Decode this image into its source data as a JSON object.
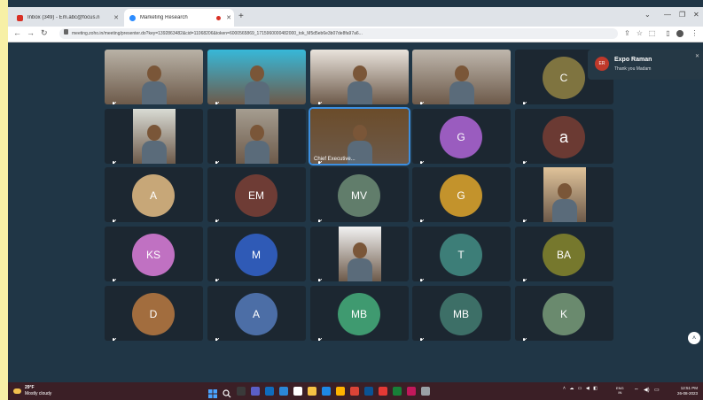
{
  "browser": {
    "tabs": [
      {
        "label": "Inbox (349) - Em.abc@focus.n",
        "favicon_color": "#d93025",
        "active": false
      },
      {
        "label": "Marketing Research",
        "favicon_color": "#2d8cff",
        "active": true
      }
    ],
    "url": "meeting.zoho.in/meeting/presenter.do?key=1392863482&cid=11068206&token=6000565869_1715960000482000_tok_M5d5eb6e3b07de8fa97a6...",
    "icons": [
      "back-icon",
      "forward-icon",
      "reload-icon",
      "lock-icon",
      "share-icon",
      "star-icon",
      "extension-icon",
      "profile-icon",
      "menu-icon"
    ]
  },
  "meeting": {
    "participants": [
      {
        "initials": "",
        "type": "video",
        "tone": "#b9b2a6"
      },
      {
        "initials": "",
        "type": "video",
        "tone": "#37b8d8"
      },
      {
        "initials": "",
        "type": "video",
        "tone": "#e9e3dc"
      },
      {
        "initials": "",
        "type": "video",
        "tone": "#bfb7ad"
      },
      {
        "initials": "C",
        "type": "avatar",
        "color": "#7f7440"
      },
      {
        "initials": "",
        "type": "video",
        "tone": "#d9dbd4"
      },
      {
        "initials": "",
        "type": "video",
        "tone": "#a59d90"
      },
      {
        "initials": "",
        "type": "video",
        "tone": "#6b4c2a",
        "caption": "Chief Executive...",
        "speaking": true
      },
      {
        "initials": "G",
        "type": "avatar",
        "color": "#9a5cbf"
      },
      {
        "initials": "a",
        "type": "avatar",
        "color": "#6b3a33",
        "big": true
      },
      {
        "initials": "A",
        "type": "avatar",
        "color": "#c7a778"
      },
      {
        "initials": "EM",
        "type": "avatar",
        "color": "#6e3c35"
      },
      {
        "initials": "MV",
        "type": "avatar",
        "color": "#617d6b"
      },
      {
        "initials": "G",
        "type": "avatar",
        "color": "#c3932c"
      },
      {
        "initials": "",
        "type": "video",
        "tone": "#e0c39a"
      },
      {
        "initials": "KS",
        "type": "avatar",
        "color": "#c071c2"
      },
      {
        "initials": "M",
        "type": "avatar",
        "color": "#2f5ab6"
      },
      {
        "initials": "",
        "type": "video",
        "tone": "#f2f2f2"
      },
      {
        "initials": "T",
        "type": "avatar",
        "color": "#3d7e78"
      },
      {
        "initials": "BA",
        "type": "avatar",
        "color": "#76782d"
      },
      {
        "initials": "D",
        "type": "avatar",
        "color": "#a26d3e"
      },
      {
        "initials": "A",
        "type": "avatar",
        "color": "#4c6ea6"
      },
      {
        "initials": "MB",
        "type": "avatar",
        "color": "#3f9a70"
      },
      {
        "initials": "MB",
        "type": "avatar",
        "color": "#3d6f67"
      },
      {
        "initials": "K",
        "type": "avatar",
        "color": "#6a8a6e"
      }
    ],
    "notification": {
      "initials": "ER",
      "name": "Expo Raman",
      "message": "Thank you Madam"
    }
  },
  "taskbar": {
    "weather_temp": "29°F",
    "weather_desc": "Mostly cloudy",
    "lang_line1": "ENG",
    "lang_line2": "IN",
    "time": "12:51 PM",
    "date": "26-08-2023",
    "app_colors": [
      "#1a73e8",
      "#ffffff",
      "#3a3a3a",
      "#5b5fc7",
      "#0f6cbd",
      "#2b88d8",
      "#ffffff",
      "#f6c244",
      "#1e88e5",
      "#ffb300",
      "#db4437",
      "#0b5394",
      "#e53935",
      "#188038",
      "#c2185b",
      "#9aa0a6"
    ]
  }
}
